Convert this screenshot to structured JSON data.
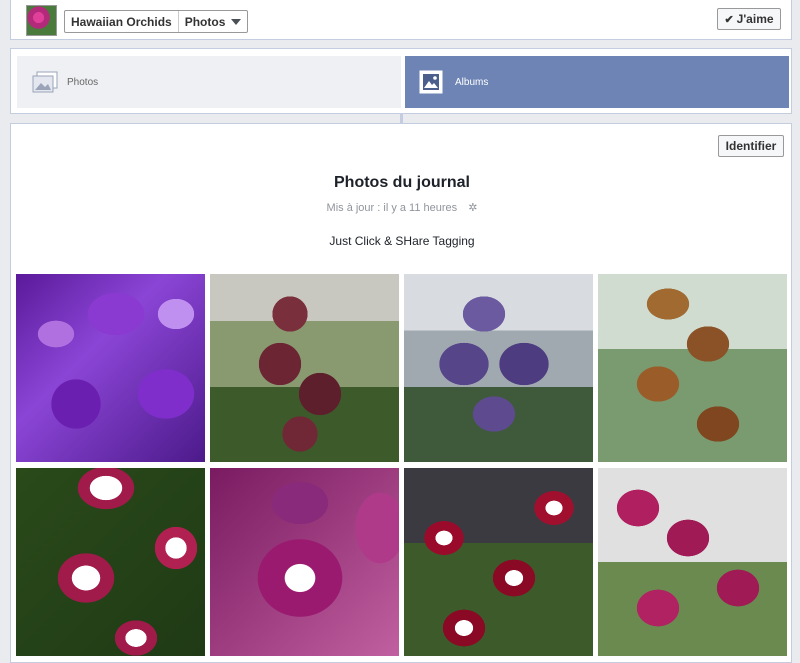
{
  "header": {
    "page_name": "Hawaiian Orchids",
    "section": "Photos",
    "like_label": "J'aime",
    "like_icon": "check-icon"
  },
  "tabs": [
    {
      "label": "Photos",
      "icon": "photos-icon",
      "active": false
    },
    {
      "label": "Albums",
      "icon": "albums-icon",
      "active": true
    }
  ],
  "album": {
    "identify_label": "Identifier",
    "title": "Photos du journal",
    "updated": "Mis à jour : il y a 11 heures",
    "settings_icon": "gear-icon",
    "description": "Just Click & SHare Tagging"
  },
  "colors": {
    "accent": "#6d84b4",
    "background": "#e9ebee"
  },
  "photos_count": 8
}
